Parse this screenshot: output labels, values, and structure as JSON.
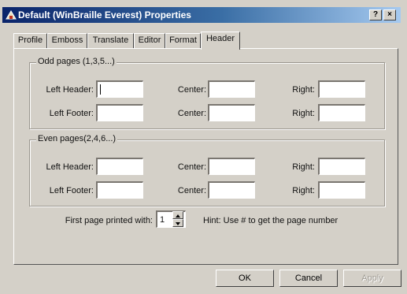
{
  "window": {
    "title": "Default (WinBraille Everest) Properties",
    "help_label": "?",
    "close_label": "×"
  },
  "tabs": [
    {
      "label": "Profile"
    },
    {
      "label": "Emboss"
    },
    {
      "label": "Translate"
    },
    {
      "label": "Editor"
    },
    {
      "label": "Format"
    },
    {
      "label": "Header",
      "active": true
    }
  ],
  "odd": {
    "group_label": "Odd pages (1,3,5...)",
    "left_header_label": "Left Header:",
    "left_footer_label": "Left Footer:",
    "center_label": "Center:",
    "right_label": "Right:",
    "left_header_value": "",
    "center_header_value": "",
    "right_header_value": "",
    "left_footer_value": "",
    "center_footer_value": "",
    "right_footer_value": ""
  },
  "even": {
    "group_label": "Even pages(2,4,6...)",
    "left_header_label": "Left Header:",
    "left_footer_label": "Left Footer:",
    "center_label": "Center:",
    "right_label": "Right:",
    "left_header_value": "",
    "center_header_value": "",
    "right_header_value": "",
    "left_footer_value": "",
    "center_footer_value": "",
    "right_footer_value": ""
  },
  "first_page": {
    "label": "First page printed with:",
    "value": "1"
  },
  "hint": "Hint: Use # to get the page number",
  "buttons": {
    "ok": "OK",
    "cancel": "Cancel",
    "apply": "Apply"
  }
}
